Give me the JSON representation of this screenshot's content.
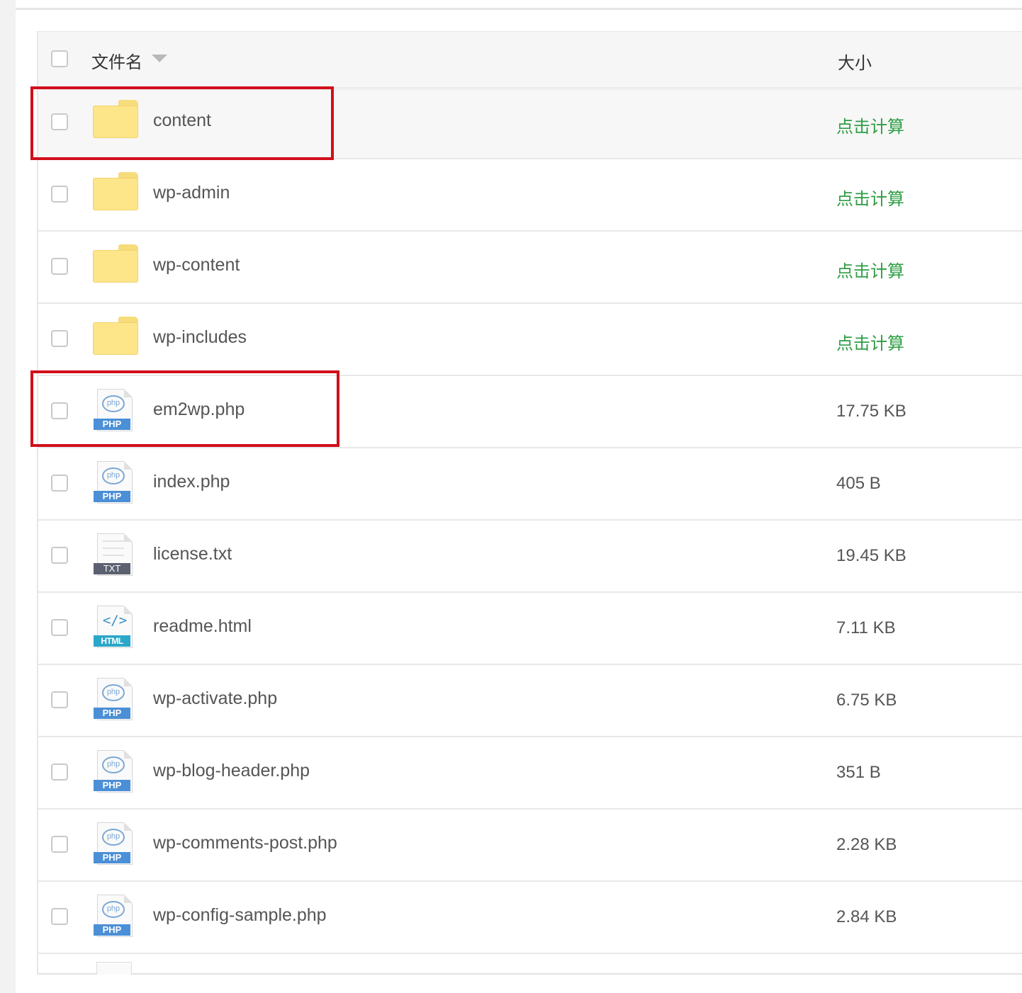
{
  "header": {
    "name_label": "文件名",
    "size_label": "大小"
  },
  "files": [
    {
      "name": "content",
      "size": "点击计算",
      "type": "folder"
    },
    {
      "name": "wp-admin",
      "size": "点击计算",
      "type": "folder"
    },
    {
      "name": "wp-content",
      "size": "点击计算",
      "type": "folder"
    },
    {
      "name": "wp-includes",
      "size": "点击计算",
      "type": "folder"
    },
    {
      "name": "em2wp.php",
      "size": "17.75 KB",
      "type": "php",
      "badge": "PHP"
    },
    {
      "name": "index.php",
      "size": "405 B",
      "type": "php",
      "badge": "PHP"
    },
    {
      "name": "license.txt",
      "size": "19.45 KB",
      "type": "txt",
      "badge": "TXT"
    },
    {
      "name": "readme.html",
      "size": "7.11 KB",
      "type": "html",
      "badge": "HTML",
      "glyph": "</>"
    },
    {
      "name": "wp-activate.php",
      "size": "6.75 KB",
      "type": "php",
      "badge": "PHP"
    },
    {
      "name": "wp-blog-header.php",
      "size": "351 B",
      "type": "php",
      "badge": "PHP"
    },
    {
      "name": "wp-comments-post.php",
      "size": "2.28 KB",
      "type": "php",
      "badge": "PHP"
    },
    {
      "name": "wp-config-sample.php",
      "size": "2.84 KB",
      "type": "php",
      "badge": "PHP"
    }
  ],
  "php_icon_text": "php",
  "colors": {
    "calc_link": "#2e9e44",
    "highlight": "#d10f1b",
    "folder": "#fde58a",
    "php_badge": "#4b8fd6"
  }
}
